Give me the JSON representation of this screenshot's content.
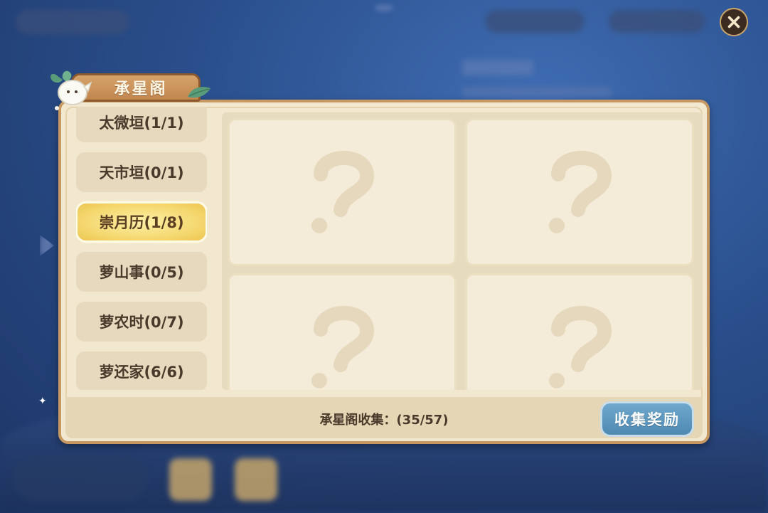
{
  "window": {
    "title": "承星阁"
  },
  "sidebar": {
    "items": [
      {
        "label": "太微垣(1/1)",
        "active": false
      },
      {
        "label": "天市垣(0/1)",
        "active": false
      },
      {
        "label": "崇月历(1/8)",
        "active": true
      },
      {
        "label": "萝山事(0/5)",
        "active": false
      },
      {
        "label": "萝农时(0/7)",
        "active": false
      },
      {
        "label": "萝还家(6/6)",
        "active": false
      }
    ]
  },
  "grid": {
    "cards": [
      {
        "state": "locked",
        "icon": "question-mark-icon"
      },
      {
        "state": "locked",
        "icon": "question-mark-icon"
      },
      {
        "state": "locked",
        "icon": "question-mark-icon"
      },
      {
        "state": "locked",
        "icon": "question-mark-icon"
      }
    ]
  },
  "footer": {
    "collect_label": "承星阁收集：(35/57)",
    "reward_button": "收集奖励"
  },
  "colors": {
    "panel_bg": "#f2e7cf",
    "panel_border": "#c89862",
    "active_tab": "#f3d56a",
    "reward_button": "#4e89b3",
    "background": "#2a4f8c"
  },
  "icons": [
    "close-icon",
    "question-mark-icon",
    "radish-mascot-icon",
    "leaf-icon",
    "sparkle-icon"
  ]
}
